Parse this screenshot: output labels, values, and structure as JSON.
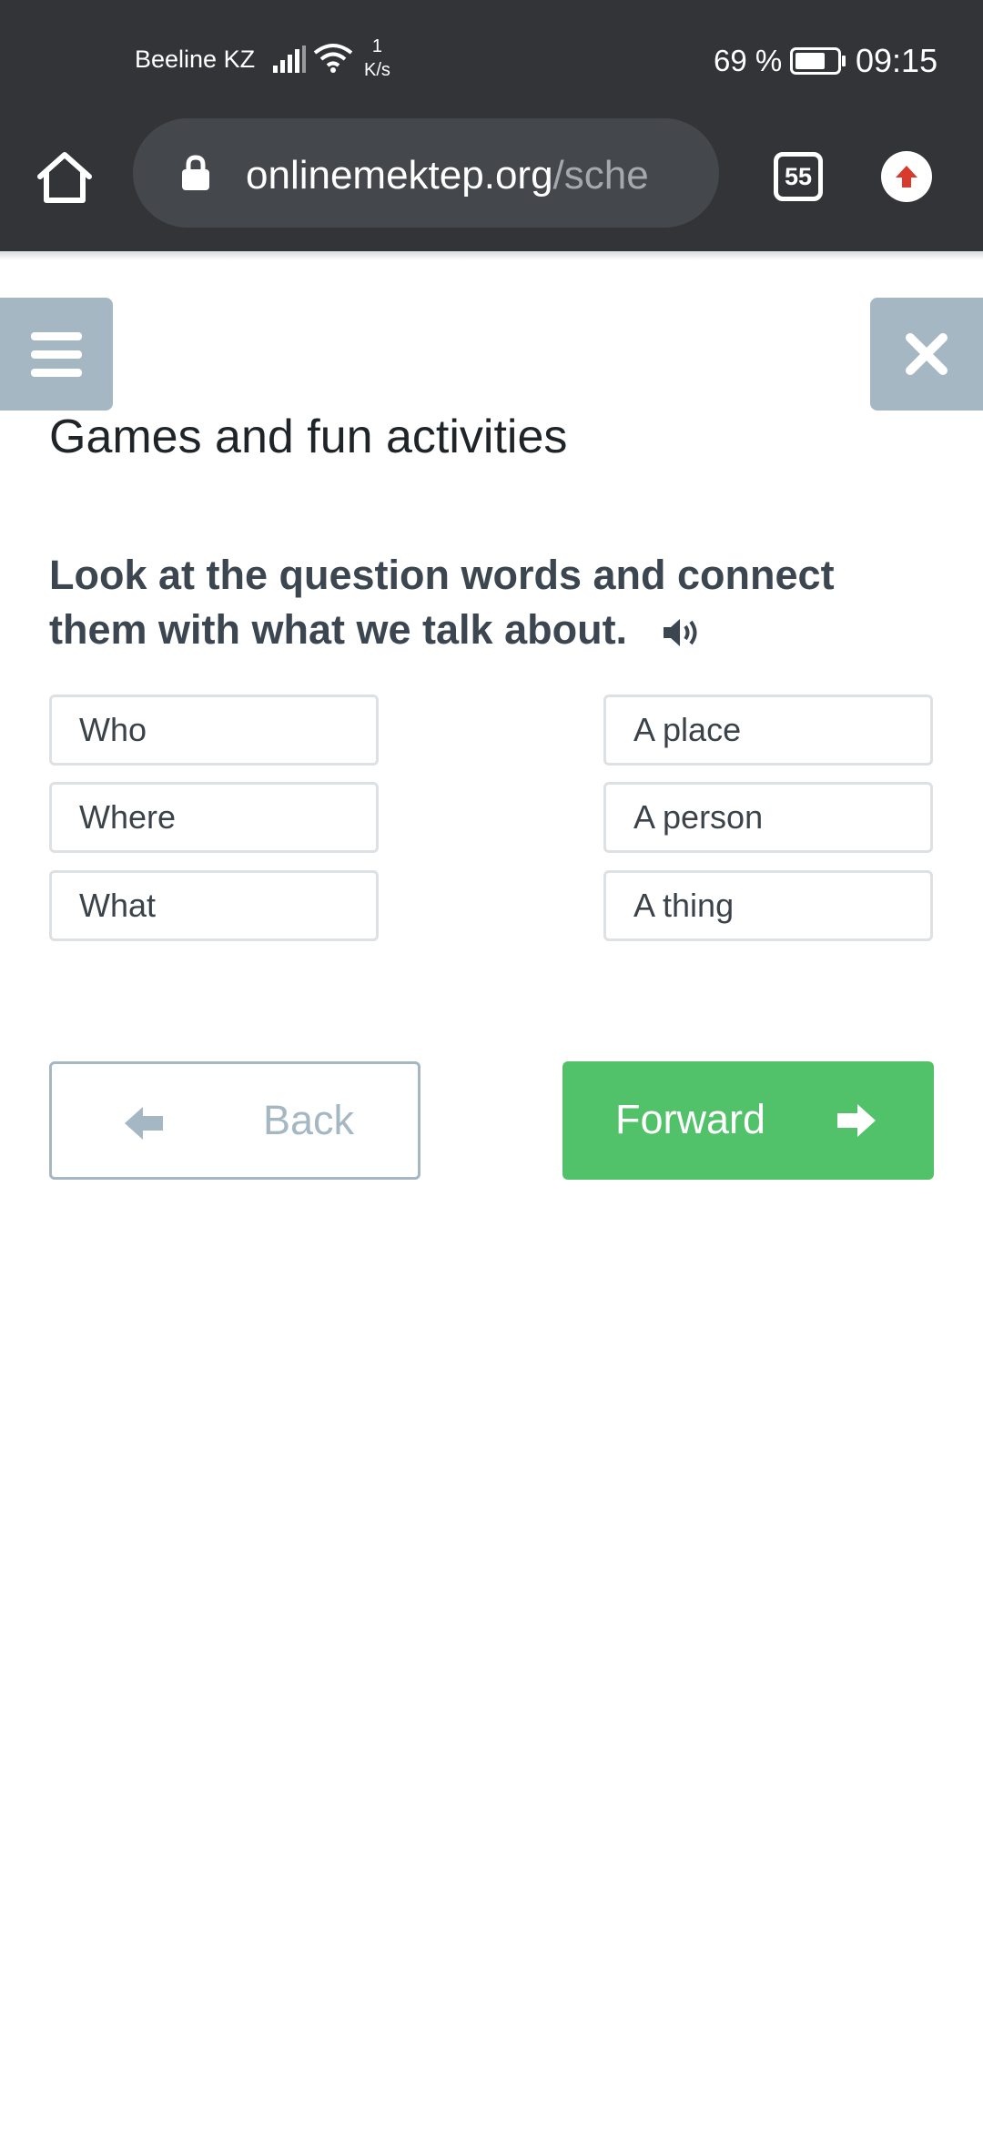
{
  "status_bar": {
    "carrier": "Beeline KZ",
    "net_speed_value": "1",
    "net_speed_unit": "K/s",
    "battery": "69 %",
    "time": "09:15",
    "icons": [
      "signal-icon",
      "wifi-icon",
      "battery-icon"
    ]
  },
  "browser": {
    "url_host": "onlinemektep.org",
    "url_path": "/sche",
    "tab_count": "55",
    "icons": [
      "home-icon",
      "lock-icon",
      "tabs-icon",
      "update-icon"
    ]
  },
  "page": {
    "title": "Games and fun activities",
    "question": "Look at the question words and connect them with what we talk about.",
    "left_items": [
      "Who",
      "Where",
      "What"
    ],
    "right_items": [
      "A place",
      "A person",
      "A thing"
    ],
    "back_label": "Back",
    "forward_label": "Forward",
    "icons": [
      "menu-icon",
      "close-icon",
      "speaker-icon",
      "arrow-left-icon",
      "arrow-right-icon"
    ]
  },
  "colors": {
    "chrome_dark": "#323438",
    "accent_grey": "#a5b7c3",
    "forward_green": "#52c26a"
  }
}
